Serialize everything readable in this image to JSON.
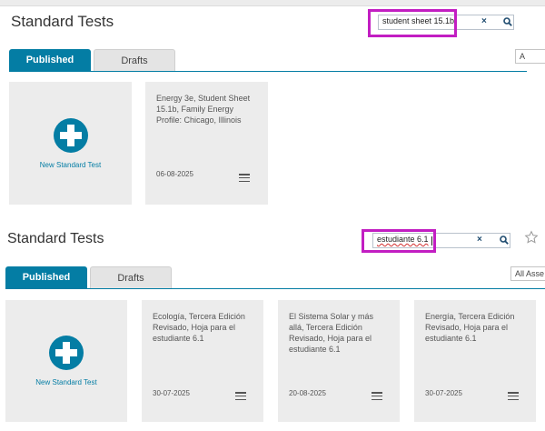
{
  "panel1": {
    "title": "Standard Tests",
    "search_value": "student sheet 15.1b",
    "clear_glyph": "×",
    "tabs": [
      "Published",
      "Drafts"
    ],
    "dropdown_text": "A",
    "new_card_label": "New Standard Test",
    "cards": [
      {
        "title": "Energy 3e, Student Sheet 15.1b, Family Energy Profile: Chicago, Illinois",
        "date": "06-08-2025"
      }
    ]
  },
  "panel2": {
    "title": "Standard Tests",
    "search_value": "estudiante 6.1",
    "clear_glyph": "×",
    "tabs": [
      "Published",
      "Drafts"
    ],
    "dropdown_text": "All Asse",
    "new_card_label": "New Standard Test",
    "cards": [
      {
        "title": "Ecología, Tercera Edición Revisado, Hoja para el estudiante 6.1",
        "date": "30-07-2025"
      },
      {
        "title": "El Sistema Solar y más allá, Tercera Edición Revisado, Hoja para el estudiante 6.1",
        "date": "20-08-2025"
      },
      {
        "title": "Energía, Tercera Edición Revisado, Hoja para el estudiante 6.1",
        "date": "30-07-2025"
      }
    ]
  },
  "colors": {
    "accent": "#047da4",
    "highlight": "#c21ec2",
    "card_bg": "#ececec"
  }
}
